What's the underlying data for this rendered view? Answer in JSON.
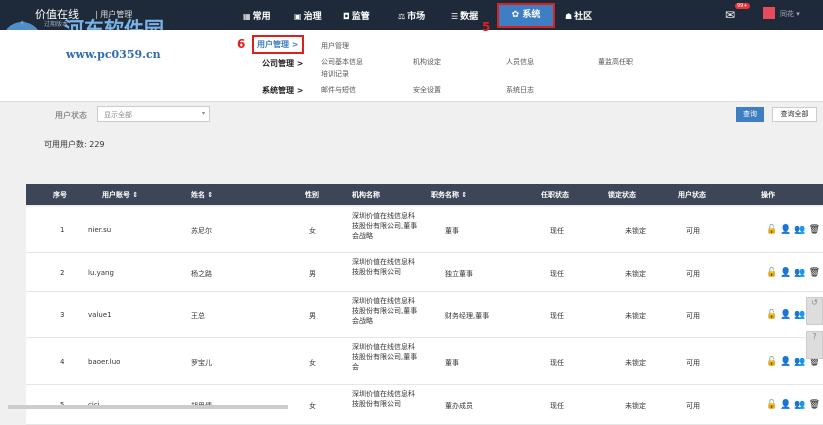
{
  "header": {
    "brand": "价值在线",
    "sep": "|",
    "module": "用户管理",
    "tiny": "过期版本",
    "dot": "★",
    "nav": [
      {
        "label": "常用",
        "icon": "▦"
      },
      {
        "label": "治理",
        "icon": "▣"
      },
      {
        "label": "监管",
        "icon": "◘"
      },
      {
        "label": "市场",
        "icon": "⚖"
      },
      {
        "label": "数据",
        "icon": "☰"
      },
      {
        "label": "系统",
        "icon": "✿"
      },
      {
        "label": "社区",
        "icon": "☗"
      }
    ],
    "mail_badge": "99+",
    "user": "同花 ▾"
  },
  "watermark": {
    "name": "河东软件园",
    "url": "www.pc0359.cn"
  },
  "annotations": {
    "a6": "6",
    "a5": "5"
  },
  "submenu": {
    "user_mgmt": {
      "label": "用户管理 >",
      "items": [
        "用户管理"
      ]
    },
    "company_mgmt": {
      "label": "公司管理 >",
      "items": [
        "公司基本信息",
        "机构设定",
        "人员信息",
        "董监高任职",
        "培训记录"
      ]
    },
    "system_mgmt": {
      "label": "系统管理 >",
      "items": [
        "邮件与短信",
        "安全设置",
        "系统日志"
      ]
    }
  },
  "filter": {
    "label": "用户状态",
    "select_value": "显示全部",
    "caret": "▾",
    "search_btn": "查询",
    "all_btn": "查询全部"
  },
  "count": {
    "label": "可用用户数:",
    "value": "229"
  },
  "table": {
    "headers": [
      "序号",
      "用户账号 ⇕",
      "姓名 ⇕",
      "性别",
      "机构名称",
      "职务名称 ⇕",
      "任职状态",
      "锁定状态",
      "用户状态",
      "操作"
    ],
    "rows": [
      {
        "no": "1",
        "acct": "nier.su",
        "name": "苏尼尔",
        "sex": "女",
        "org": [
          "深圳价值在线信息科",
          "技股份有限公司,董事",
          "会战略"
        ],
        "title": "董事",
        "job": "现任",
        "lock": "未锁定",
        "status": "可用",
        "ops": "🔓👤👥🗑"
      },
      {
        "no": "2",
        "acct": "lu.yang",
        "name": "杨之路",
        "sex": "男",
        "org": [
          "深圳价值在线信息科",
          "技股份有限公司"
        ],
        "title": "独立董事",
        "job": "现任",
        "lock": "未锁定",
        "status": "可用",
        "ops": "🔓👤👥🗑"
      },
      {
        "no": "3",
        "acct": "value1",
        "name": "王总",
        "sex": "男",
        "org": [
          "深圳价值在线信息科",
          "技股份有限公司,董事",
          "会战略"
        ],
        "title": "财务经理,董事",
        "job": "现任",
        "lock": "未锁定",
        "status": "可用",
        "ops": "🔓👤👥🗑"
      },
      {
        "no": "4",
        "acct": "baoer.luo",
        "name": "罗宝儿",
        "sex": "女",
        "org": [
          "深圳价值在线信息科",
          "技股份有限公司,董事",
          "会"
        ],
        "title": "董事",
        "job": "现任",
        "lock": "未锁定",
        "status": "可用",
        "ops": "🔓👤👥🗑"
      },
      {
        "no": "5",
        "acct": "cici",
        "name": "胡思倩",
        "sex": "女",
        "org": [
          "深圳价值在线信息科",
          "技股份有限公司"
        ],
        "title": "董办成员",
        "job": "现任",
        "lock": "未锁定",
        "status": "可用",
        "ops": "🔓👤👥🗑"
      }
    ]
  },
  "colors": {
    "topbar": "#1e2a3a",
    "accent": "#3d7fc2",
    "highlight": "#d9221c",
    "thead": "#3c4656"
  }
}
